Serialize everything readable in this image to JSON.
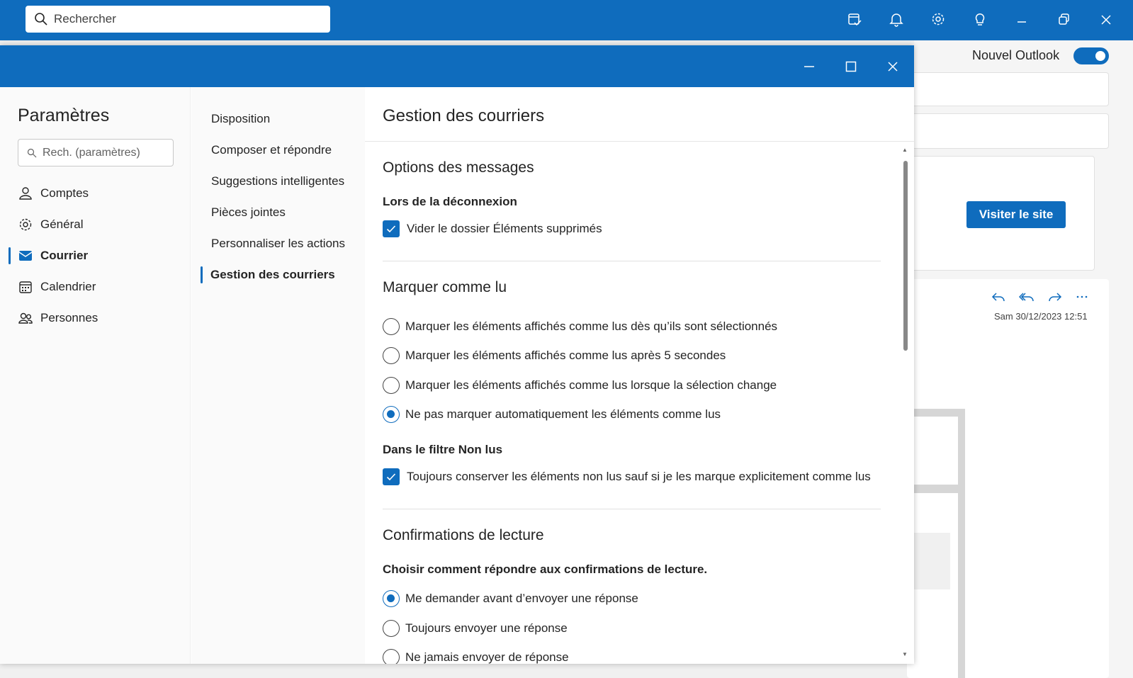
{
  "topbar": {
    "search_placeholder": "Rechercher",
    "icons": [
      "calendar-check-icon",
      "bell-icon",
      "gear-icon",
      "lightbulb-icon",
      "minimize-icon",
      "restore-icon",
      "close-icon"
    ]
  },
  "background": {
    "nouvel_outlook_label": "Nouvel Outlook",
    "nouvel_outlook_enabled": true,
    "visit_button": "Visiter le site",
    "mail_date": "Sam 30/12/2023 12:51"
  },
  "settings": {
    "title": "Paramètres",
    "search_placeholder": "Rech. (paramètres)",
    "nav": [
      {
        "label": "Comptes",
        "icon": "person-icon"
      },
      {
        "label": "Général",
        "icon": "gear-icon"
      },
      {
        "label": "Courrier",
        "icon": "mail-icon",
        "active": true
      },
      {
        "label": "Calendrier",
        "icon": "calendar-icon"
      },
      {
        "label": "Personnes",
        "icon": "people-icon"
      }
    ],
    "subnav": [
      {
        "label": "Disposition"
      },
      {
        "label": "Composer et répondre"
      },
      {
        "label": "Suggestions intelligentes"
      },
      {
        "label": "Pièces jointes"
      },
      {
        "label": "Personnaliser les actions"
      },
      {
        "label": "Gestion des courriers",
        "active": true
      }
    ],
    "page_title": "Gestion des courriers",
    "sections": {
      "options": {
        "title": "Options des messages",
        "subtitle": "Lors de la déconnexion",
        "checkbox_label": "Vider le dossier Éléments supprimés",
        "checked": true
      },
      "mark_read": {
        "title": "Marquer comme lu",
        "options": [
          "Marquer les éléments affichés comme lus dès qu’ils sont sélectionnés",
          "Marquer les éléments affichés comme lus après 5 secondes",
          "Marquer les éléments affichés comme lus lorsque la sélection change",
          "Ne pas marquer automatiquement les éléments comme lus"
        ],
        "selected_index": 3,
        "unread_filter_title": "Dans le filtre Non lus",
        "unread_checkbox_label": "Toujours conserver les éléments non lus sauf si je les marque explicitement comme lus",
        "unread_checked": true
      },
      "receipts": {
        "title": "Confirmations de lecture",
        "subtitle": "Choisir comment répondre aux confirmations de lecture.",
        "options": [
          "Me demander avant d’envoyer une réponse",
          "Toujours envoyer une réponse",
          "Ne jamais envoyer de réponse"
        ],
        "selected_index": 0
      }
    }
  }
}
